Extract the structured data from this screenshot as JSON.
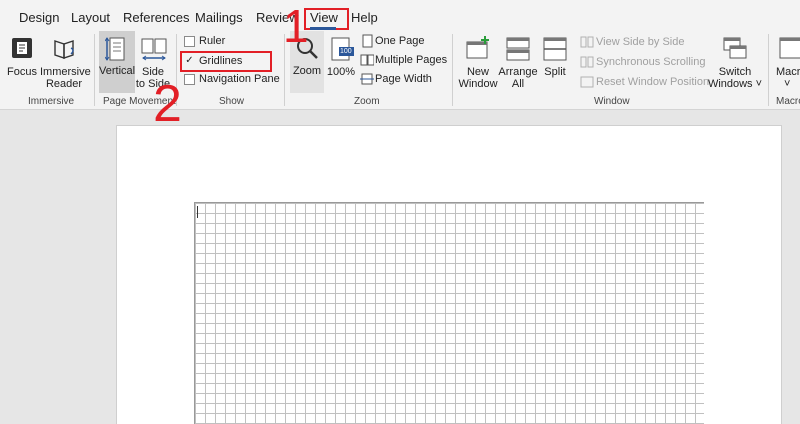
{
  "menu": {
    "tabs": [
      "Design",
      "Layout",
      "References",
      "Mailings",
      "Review",
      "View",
      "Help"
    ]
  },
  "ribbon": {
    "immersive": {
      "focus": "Focus",
      "immersive_reader_1": "Immersive",
      "immersive_reader_2": "Reader",
      "group": "Immersive"
    },
    "page_movement": {
      "vertical": "Vertical",
      "side_1": "Side",
      "side_2": "to Side",
      "group": "Page Movement"
    },
    "show": {
      "ruler": "Ruler",
      "gridlines": "Gridlines",
      "navigation_pane": "Navigation Pane",
      "gridlines_checked": "✓",
      "group": "Show"
    },
    "zoom": {
      "zoom": "Zoom",
      "hundred": "100%",
      "hundred_icon": "100",
      "one_page": "One Page",
      "multiple_pages": "Multiple Pages",
      "page_width": "Page Width",
      "group": "Zoom"
    },
    "window": {
      "new_1": "New",
      "new_2": "Window",
      "arrange_1": "Arrange",
      "arrange_2": "All",
      "split": "Split",
      "view_side": "View Side by Side",
      "sync_scroll": "Synchronous Scrolling",
      "reset_pos": "Reset Window Position",
      "switch_1": "Switch",
      "switch_2": "Windows ˅",
      "group": "Window"
    },
    "macros": {
      "macros_1": "Macro",
      "macros_2": "˅",
      "group": "Macro"
    }
  },
  "annotations": {
    "step1": "1",
    "step2": "2"
  },
  "colors": {
    "accent": "#2b579a",
    "annotation": "#e21f26"
  }
}
